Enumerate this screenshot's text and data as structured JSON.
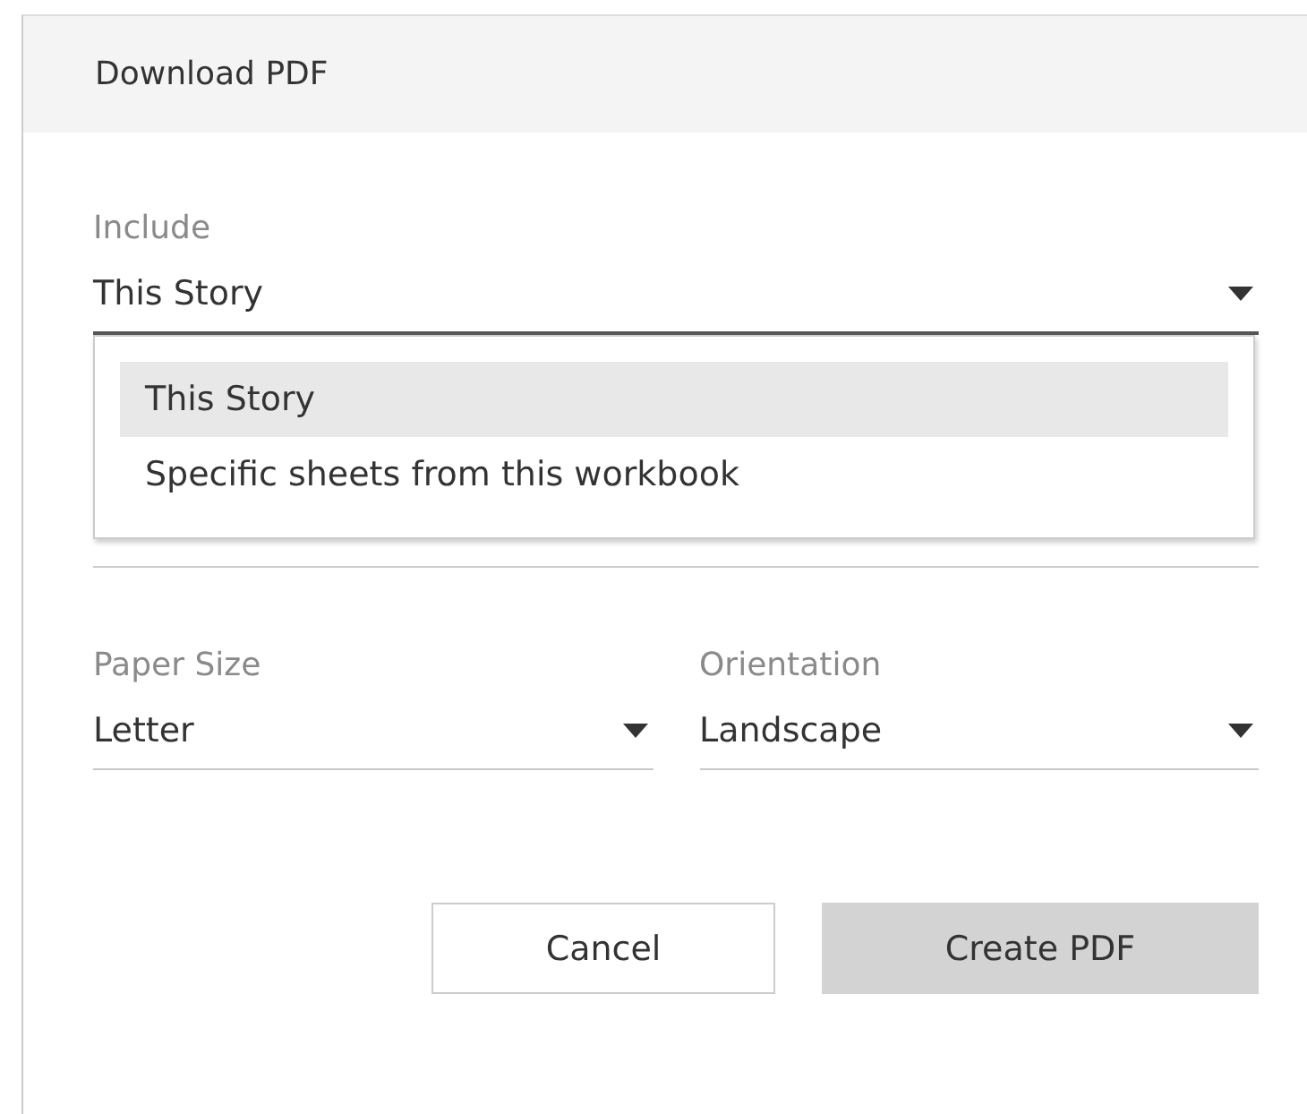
{
  "dialog": {
    "title": "Download PDF"
  },
  "include": {
    "label": "Include",
    "value": "This Story",
    "expanded": true,
    "options": [
      {
        "label": "This Story",
        "selected": true
      },
      {
        "label": "Specific sheets from this workbook",
        "selected": false
      }
    ]
  },
  "paper_size": {
    "label": "Paper Size",
    "value": "Letter"
  },
  "orientation": {
    "label": "Orientation",
    "value": "Landscape"
  },
  "buttons": [
    {
      "label": "Cancel",
      "kind": "secondary"
    },
    {
      "label": "Create PDF",
      "kind": "primary"
    }
  ]
}
